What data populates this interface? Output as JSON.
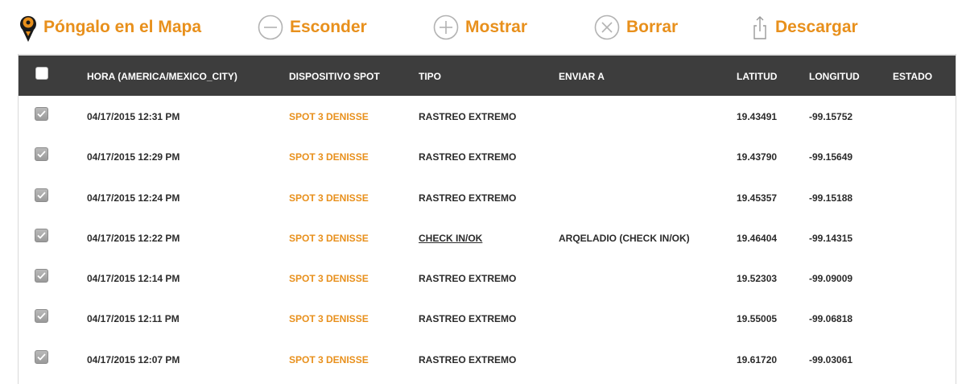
{
  "toolbar": {
    "map_label": "Póngalo en el Mapa",
    "hide_label": "Esconder",
    "show_label": "Mostrar",
    "delete_label": "Borrar",
    "download_label": "Descargar",
    "accent_color": "#e8901c"
  },
  "table": {
    "header_bg": "#3d3d3d",
    "columns": {
      "time": "HORA (AMERICA/MEXICO_CITY)",
      "device": "DISPOSITIVO SPOT",
      "type": "TIPO",
      "send_to": "ENVIAR A",
      "latitude": "LATITUD",
      "longitude": "LONGITUD",
      "status": "ESTADO"
    },
    "select_all_checked": false,
    "rows": [
      {
        "checked": true,
        "time": "04/17/2015 12:31 PM",
        "device": "SPOT 3 DENISSE",
        "type": "RASTREO EXTREMO",
        "send_to": "",
        "latitude": "19.43491",
        "longitude": "-99.15752",
        "status": ""
      },
      {
        "checked": true,
        "time": "04/17/2015 12:29 PM",
        "device": "SPOT 3 DENISSE",
        "type": "RASTREO EXTREMO",
        "send_to": "",
        "latitude": "19.43790",
        "longitude": "-99.15649",
        "status": ""
      },
      {
        "checked": true,
        "time": "04/17/2015 12:24 PM",
        "device": "SPOT 3 DENISSE",
        "type": "RASTREO EXTREMO",
        "send_to": "",
        "latitude": "19.45357",
        "longitude": "-99.15188",
        "status": ""
      },
      {
        "checked": true,
        "time": "04/17/2015 12:22 PM",
        "device": "SPOT 3 DENISSE",
        "type": "CHECK IN/OK",
        "send_to": "ARQELADIO (CHECK IN/OK)",
        "latitude": "19.46404",
        "longitude": "-99.14315",
        "status": ""
      },
      {
        "checked": true,
        "time": "04/17/2015 12:14 PM",
        "device": "SPOT 3 DENISSE",
        "type": "RASTREO EXTREMO",
        "send_to": "",
        "latitude": "19.52303",
        "longitude": "-99.09009",
        "status": ""
      },
      {
        "checked": true,
        "time": "04/17/2015 12:11 PM",
        "device": "SPOT 3 DENISSE",
        "type": "RASTREO EXTREMO",
        "send_to": "",
        "latitude": "19.55005",
        "longitude": "-99.06818",
        "status": ""
      },
      {
        "checked": true,
        "time": "04/17/2015 12:07 PM",
        "device": "SPOT 3 DENISSE",
        "type": "RASTREO EXTREMO",
        "send_to": "",
        "latitude": "19.61720",
        "longitude": "-99.03061",
        "status": ""
      }
    ]
  }
}
